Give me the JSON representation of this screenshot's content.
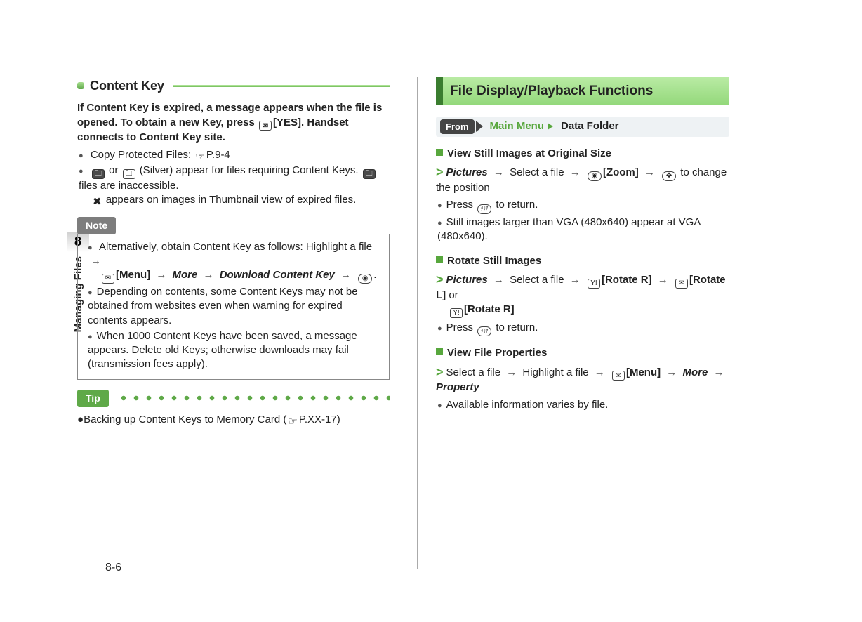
{
  "side": {
    "chapter_num": "8",
    "chapter_label": "Managing Files"
  },
  "page_number": "8-6",
  "left": {
    "subheader": "Content Key",
    "intro": "If Content Key is expired, a message appears when the file is opened. To obtain a new Key, press",
    "intro_btn": "[YES].",
    "intro2": "Handset connects to Content Key site.",
    "bullets": [
      {
        "pre": "Copy Protected Files:",
        "ref": "P.9-4"
      },
      {
        "pre_b": "or",
        "mid": "(Silver) appear for files requiring Content Keys.",
        "mid2": "files are inaccessible.",
        "post": "appears on images in Thumbnail view of expired files."
      }
    ],
    "note_label": "Note",
    "note_items": {
      "a1": "Alternatively, obtain Content Key as follows: Highlight a file",
      "a_menu": "[Menu]",
      "a_more": "More",
      "a_dl": "Download Content Key",
      "b": "Depending on contents, some Content Keys may not be obtained from websites even when warning for expired contents appears.",
      "c": "When 1000 Content Keys have been saved, a message appears. Delete old Keys; otherwise downloads may fail (transmission fees apply)."
    },
    "tip_label": "Tip",
    "tip_text": "Backing up Content Keys to Memory Card (",
    "tip_ref": "P.XX-17)"
  },
  "right": {
    "header": "File Display/Playback Functions",
    "from_label": "From",
    "from_main": "Main Menu",
    "from_sub": "Data Folder",
    "s1_title": "View Still Images at Original Size",
    "s1_path_a": "Pictures",
    "s1_path_b": "Select a file",
    "s1_zoom": "[Zoom]",
    "s1_path_c": "to change the position",
    "s1_b1": "Press",
    "s1_b1b": "to return.",
    "s1_b2": "Still images larger than VGA (480x640) appear at VGA (480x640).",
    "s2_title": "Rotate Still Images",
    "s2_path_a": "Pictures",
    "s2_path_b": "Select a file",
    "s2_r": "[Rotate R]",
    "s2_l": "[Rotate L]",
    "s2_or": "or",
    "s2_b1": "Press",
    "s2_b1b": "to return.",
    "s3_title": "View File Properties",
    "s3_a": "Select a file",
    "s3_b": "Highlight a file",
    "s3_menu": "[Menu]",
    "s3_more": "More",
    "s3_prop": "Property",
    "s3_bullet": "Available information varies by file."
  }
}
